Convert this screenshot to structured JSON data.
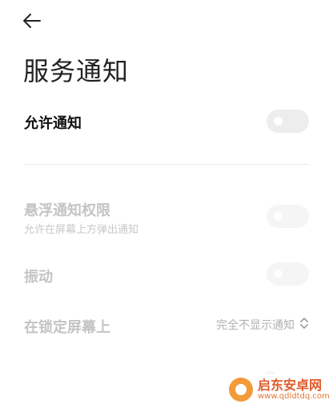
{
  "header": {
    "back_icon": "arrow-left-icon",
    "title": "服务通知"
  },
  "settings": {
    "allow_notifications": {
      "label": "允许通知",
      "enabled": false
    },
    "floating_permission": {
      "label": "悬浮通知权限",
      "sublabel": "允许在屏幕上方弹出通知",
      "enabled": false,
      "disabled": true
    },
    "vibration": {
      "label": "振动",
      "enabled": false,
      "disabled": true
    },
    "lock_screen": {
      "label": "在锁定屏幕上",
      "value": "完全不显示通知",
      "icon": "chevron-updown-icon"
    }
  },
  "watermark": {
    "name": "启东安卓网",
    "url": "www.qdldtdq.com",
    "icon": "brand-logo-icon"
  },
  "colors": {
    "title": "#222222",
    "label_active": "#111111",
    "label_disabled": "#c4c4c4",
    "toggle_off": "#ededed",
    "watermark_orange": "#f39a3a"
  }
}
